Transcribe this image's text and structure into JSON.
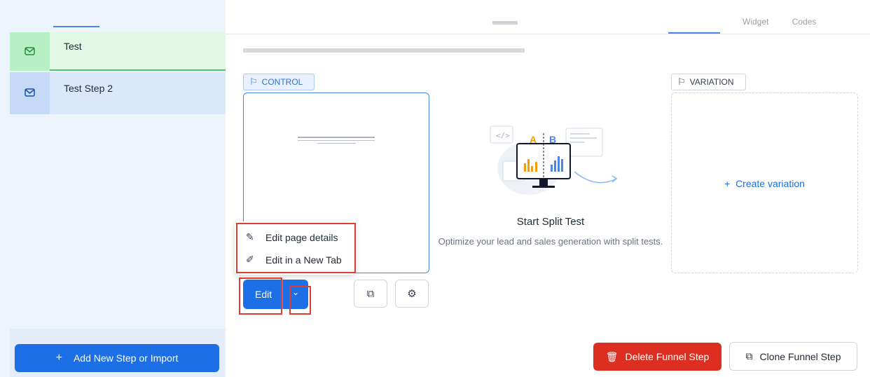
{
  "header": {
    "tabs": [
      "Widget",
      "Codes"
    ]
  },
  "sidebar": {
    "steps": [
      {
        "label": "Test",
        "icon": "mail-icon"
      },
      {
        "label": "Test Step 2",
        "icon": "mail-icon"
      }
    ],
    "add_button_label": "Add New Step or Import"
  },
  "control": {
    "badge": "CONTROL",
    "menu": [
      {
        "label": "Edit page details",
        "icon": "pencil-icon"
      },
      {
        "label": "Edit in a New Tab",
        "icon": "edit-box-icon"
      }
    ],
    "edit_label": "Edit"
  },
  "split_test": {
    "title": "Start Split Test",
    "description": "Optimize your lead and sales generation with split tests."
  },
  "variation": {
    "badge": "VARIATION",
    "create_label": "Create variation"
  },
  "footer": {
    "delete_label": "Delete Funnel Step",
    "clone_label": "Clone Funnel Step"
  },
  "colors": {
    "primary": "#1c6fe4",
    "danger": "#dc2f22",
    "highlight": "#e03c31",
    "success": "#53c46d"
  }
}
